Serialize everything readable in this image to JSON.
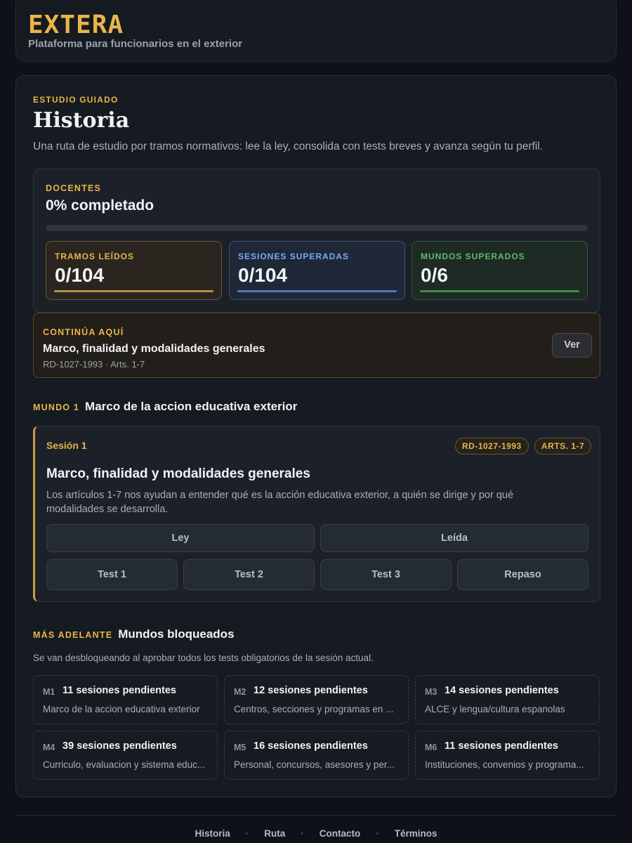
{
  "header": {
    "brand": "EXTERA",
    "tagline": "Plataforma para funcionarios en el exterior"
  },
  "page": {
    "eyebrow": "ESTUDIO GUIADO",
    "title": "Historia",
    "subtitle": "Una ruta de estudio por tramos normativos: lee la ley, consolida con tests breves y avanza según tu perfil."
  },
  "progress": {
    "profile": "DOCENTES",
    "completed_label": "0% completado",
    "completed_fraction": 0,
    "stats": [
      {
        "label": "TRAMOS LEÍDOS",
        "value": "0/104"
      },
      {
        "label": "SESIONES SUPERADAS",
        "value": "0/104"
      },
      {
        "label": "MUNDOS SUPERADOS",
        "value": "0/6"
      }
    ]
  },
  "continue": {
    "label": "CONTINÚA AQUÍ",
    "title": "Marco, finalidad y modalidades generales",
    "ref": "RD-1027-1993 · Arts. 1-7",
    "button": "Ver"
  },
  "world_current": {
    "tag": "MUNDO 1",
    "name": "Marco de la accion educativa exterior"
  },
  "session": {
    "label": "Sesión 1",
    "chips": [
      "RD-1027-1993",
      "ARTS. 1-7"
    ],
    "title": "Marco, finalidad y modalidades generales",
    "description": "Los artículos 1-7 nos ayudan a entender qué es la acción educativa exterior, a quién se dirige y por qué modalidades se desarrolla.",
    "buttons_row1": [
      "Ley",
      "Leída"
    ],
    "buttons_row2": [
      "Test 1",
      "Test 2",
      "Test 3",
      "Repaso"
    ]
  },
  "locked": {
    "tag": "MÁS ADELANTE",
    "title": "Mundos bloqueados",
    "description": "Se van desbloqueando al aprobar todos los tests obligatorios de la sesión actual.",
    "worlds": [
      {
        "code": "M1",
        "count": "11 sesiones pendientes",
        "name": "Marco de la accion educativa exterior"
      },
      {
        "code": "M2",
        "count": "12 sesiones pendientes",
        "name": "Centros, secciones y programas en ..."
      },
      {
        "code": "M3",
        "count": "14 sesiones pendientes",
        "name": "ALCE y lengua/cultura espanolas"
      },
      {
        "code": "M4",
        "count": "39 sesiones pendientes",
        "name": "Curriculo, evaluacion y sistema educ..."
      },
      {
        "code": "M5",
        "count": "16 sesiones pendientes",
        "name": "Personal, concursos, asesores y per..."
      },
      {
        "code": "M6",
        "count": "11 sesiones pendientes",
        "name": "Instituciones, convenios y programa..."
      }
    ]
  },
  "footer": {
    "links": [
      "Historia",
      "Ruta",
      "Contacto",
      "Términos"
    ],
    "separator": "·"
  }
}
